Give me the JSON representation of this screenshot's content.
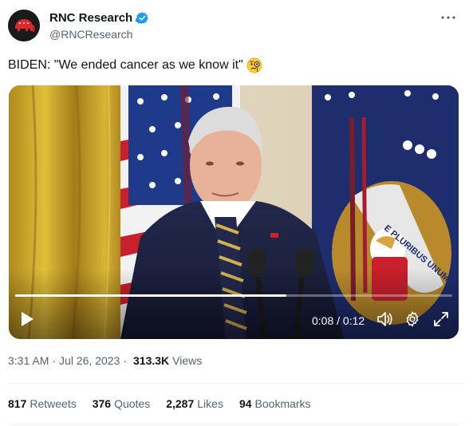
{
  "author": {
    "name": "RNC Research",
    "handle": "@RNCResearch",
    "verified": true
  },
  "more_icon": "more-horizontal-icon",
  "tweet": {
    "text": "BIDEN: \"We ended cancer as we know it\"",
    "emoji": "face-with-monocle"
  },
  "video": {
    "time": "0:08 / 0:12",
    "progress": 0.62,
    "icons": [
      "play-icon",
      "volume-icon",
      "settings-gear-icon",
      "fullscreen-icon"
    ]
  },
  "meta": {
    "time": "3:31 AM",
    "separator": "·",
    "date": "Jul 26, 2023",
    "views_count": "313.3K",
    "views_label": "Views"
  },
  "stats": [
    {
      "count": "817",
      "label": "Retweets"
    },
    {
      "count": "376",
      "label": "Quotes"
    },
    {
      "count": "2,287",
      "label": "Likes"
    },
    {
      "count": "94",
      "label": "Bookmarks"
    }
  ],
  "colors": {
    "accent": "#1d9bf0",
    "text": "#0f1419",
    "secondary": "#536471",
    "divider": "#eff3f4"
  }
}
